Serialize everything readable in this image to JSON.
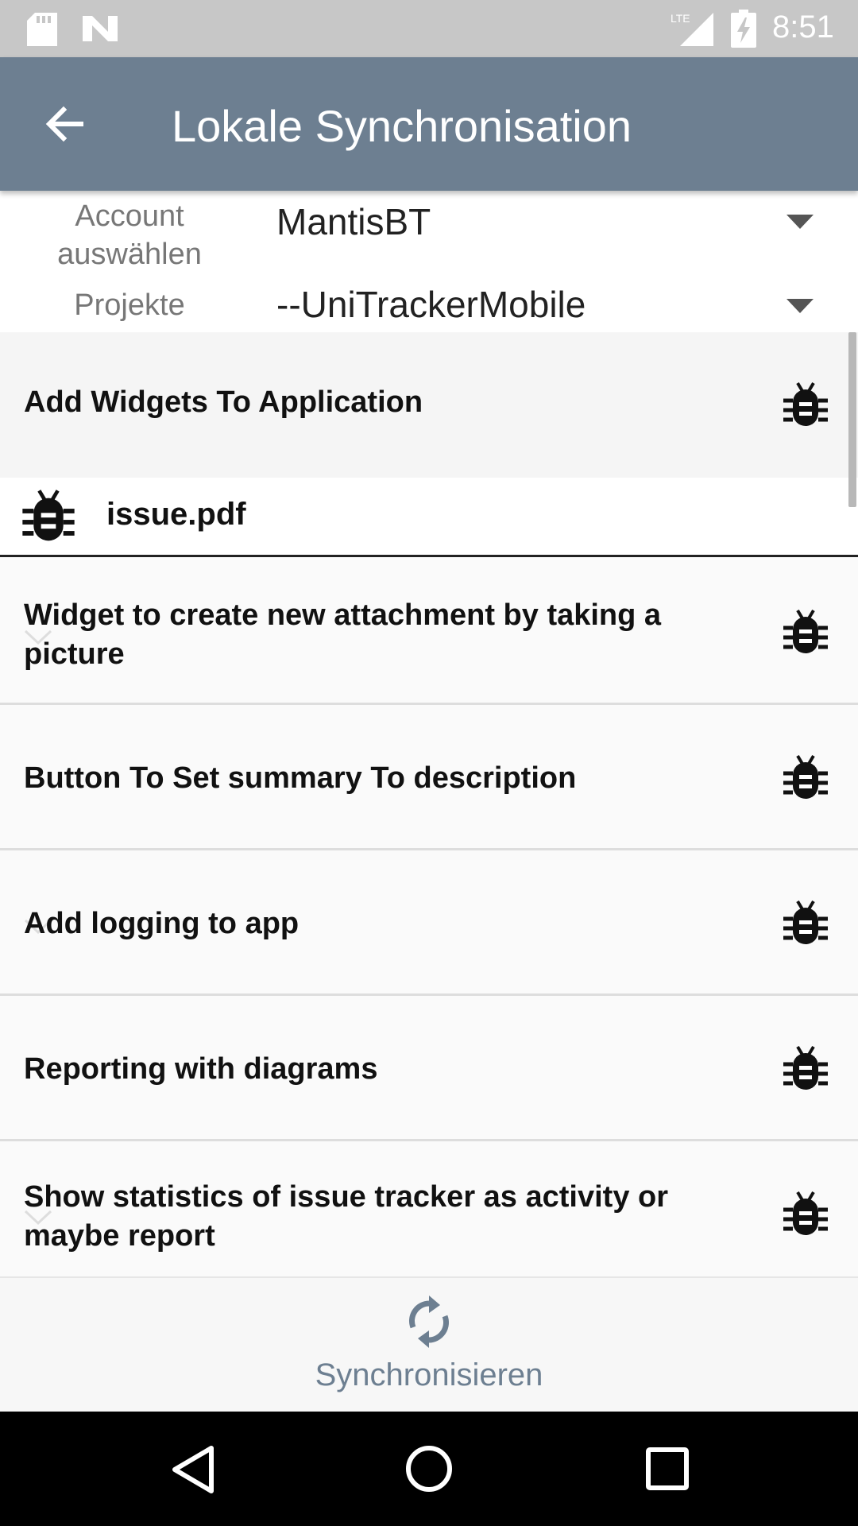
{
  "status_bar": {
    "time": "8:51",
    "network": "LTE"
  },
  "app_bar": {
    "title": "Lokale Synchronisation"
  },
  "selectors": {
    "account_label_line1": "Account",
    "account_label_line2": "auswählen",
    "account_value": "MantisBT",
    "project_label": "Projekte",
    "project_value": "--UniTrackerMobile"
  },
  "issues": [
    {
      "title": "Add Widgets To Application",
      "icon": "bug-icon"
    },
    {
      "title": "Widget to create new attachment by taking a picture",
      "icon": "bug-icon"
    },
    {
      "title": "Button To Set summary To description",
      "icon": "bug-icon"
    },
    {
      "title": "Add logging to app",
      "icon": "bug-icon"
    },
    {
      "title": "Reporting with diagrams",
      "icon": "bug-icon"
    },
    {
      "title": "Show statistics of issue tracker as activity or maybe report",
      "icon": "bug-icon"
    }
  ],
  "attachment": {
    "filename": "issue.pdf",
    "icon": "bug-icon"
  },
  "bottom_action": {
    "label": "Synchronisieren",
    "icon": "sync-icon"
  },
  "colors": {
    "app_bar": "#6d7f91",
    "status_bar": "#c7c7c7",
    "accent": "#6d7f91"
  }
}
